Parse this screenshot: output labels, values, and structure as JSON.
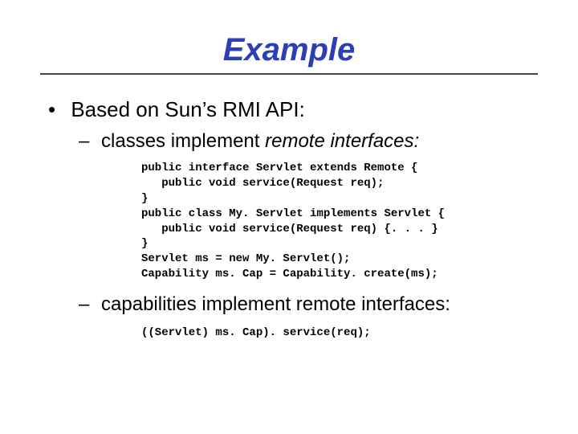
{
  "title": "Example",
  "bullets": {
    "top": "Based on Sun’s RMI API:",
    "sub1_prefix": "classes implement ",
    "sub1_italic": "remote interfaces:",
    "sub2": "capabilities implement remote interfaces:"
  },
  "code1": "public interface Servlet extends Remote {\n   public void service(Request req);\n}\npublic class My. Servlet implements Servlet {\n   public void service(Request req) {. . . }\n}\nServlet ms = new My. Servlet();\nCapability ms. Cap = Capability. create(ms);",
  "code2": "((Servlet) ms. Cap). service(req);"
}
